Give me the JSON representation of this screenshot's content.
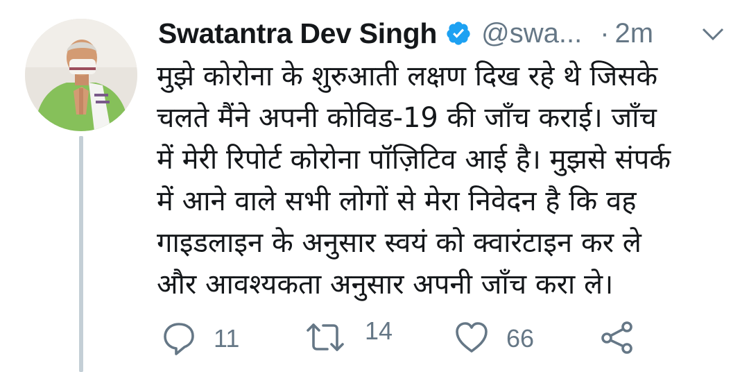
{
  "tweet": {
    "author": {
      "display_name": "Swatantra Dev Singh",
      "handle": "@swa...",
      "verified": true,
      "avatar_icon": "profile-photo"
    },
    "separator": "·",
    "timestamp": "2m",
    "text": "मुझे कोरोना के शुरुआती लक्षण दिख रहे थे जिसके\nचलते मैंने अपनी कोविड-19 की जाँच कराई। जाँच\nमें मेरी रिपोर्ट कोरोना पॉज़िटिव आई है। मुझसे संपर्क\nमें आने वाले सभी लोगों से मेरा निवेदन है कि वह\nगाइडलाइन के अनुसार स्वयं को क्वारंटाइन कर ले\nऔर आवश्यकता अनुसार अपनी जाँच करा ले।",
    "actions": {
      "reply": {
        "icon": "reply-icon",
        "count": "11"
      },
      "retweet": {
        "icon": "retweet-icon",
        "count": "14"
      },
      "like": {
        "icon": "heart-icon",
        "count": "66"
      },
      "share": {
        "icon": "share-icon"
      }
    },
    "colors": {
      "text": "#14171a",
      "secondary": "#657786",
      "verified": "#1da1f2",
      "thread_line": "#c4cfd6"
    }
  }
}
